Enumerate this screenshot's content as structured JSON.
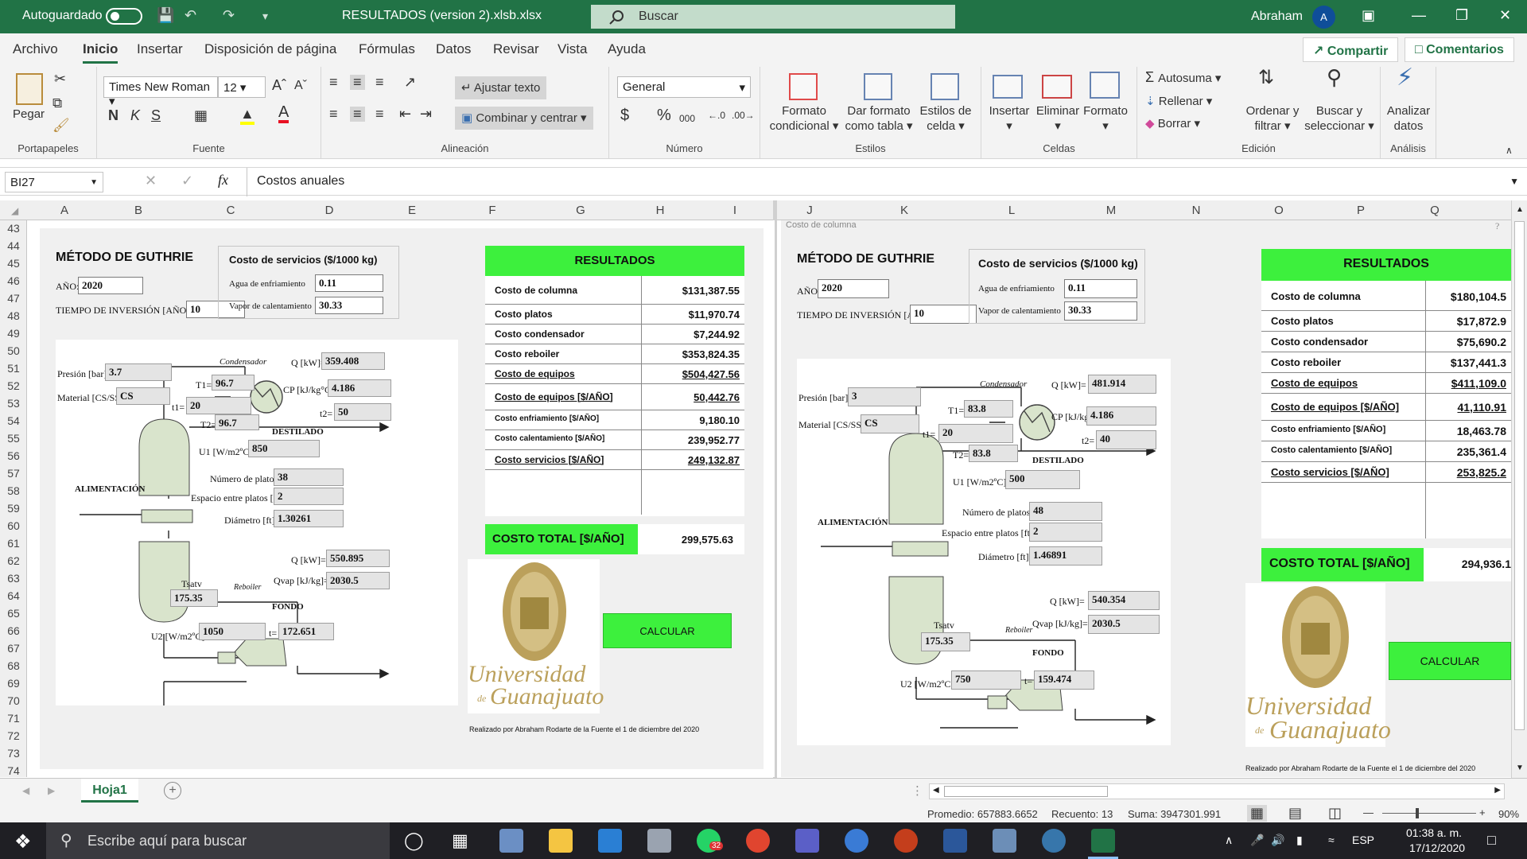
{
  "titlebar": {
    "autosave_label": "Autoguardado",
    "filename": "RESULTADOS (version 2).xlsb.xlsx",
    "search_placeholder": "Buscar",
    "user_name": "Abraham",
    "user_initial": "A"
  },
  "menu": {
    "tabs": [
      "Archivo",
      "Inicio",
      "Insertar",
      "Disposición de página",
      "Fórmulas",
      "Datos",
      "Revisar",
      "Vista",
      "Ayuda"
    ],
    "active_tab": "Inicio",
    "share_label": "Compartir",
    "comments_label": "Comentarios"
  },
  "ribbon": {
    "clipboard": {
      "paste": "Pegar",
      "group": "Portapapeles"
    },
    "font": {
      "family": "Times New Roman",
      "size": "12",
      "bold": "N",
      "italic": "K",
      "underline": "S",
      "group": "Fuente"
    },
    "alignment": {
      "wrap": "Ajustar texto",
      "merge": "Combinar y centrar",
      "group": "Alineación"
    },
    "number": {
      "format": "General",
      "percent": "%",
      "thousands": "000",
      "group": "Número"
    },
    "styles": {
      "cond1": "Formato",
      "cond2": "condicional",
      "table1": "Dar formato",
      "table2": "como tabla",
      "cell1": "Estilos de",
      "cell2": "celda",
      "group": "Estilos"
    },
    "cells": {
      "insert": "Insertar",
      "delete": "Eliminar",
      "format": "Formato",
      "group": "Celdas"
    },
    "editing": {
      "autosum": "Autosuma",
      "fill": "Rellenar",
      "clear": "Borrar",
      "sort1": "Ordenar y",
      "sort2": "filtrar",
      "find1": "Buscar y",
      "find2": "seleccionar",
      "group": "Edición"
    },
    "analysis": {
      "analyze1": "Analizar",
      "analyze2": "datos",
      "group": "Análisis"
    }
  },
  "formula_bar": {
    "cell_ref": "BI27",
    "content": "Costos anuales"
  },
  "columns_left": [
    "A",
    "B",
    "C",
    "D",
    "E",
    "F",
    "G",
    "H",
    "I"
  ],
  "columns_right": [
    "J",
    "K",
    "L",
    "M",
    "N",
    "O",
    "P",
    "Q"
  ],
  "rows": [
    "43",
    "44",
    "45",
    "46",
    "47",
    "48",
    "49",
    "50",
    "51",
    "52",
    "53",
    "54",
    "55",
    "56",
    "57",
    "58",
    "59",
    "60",
    "61",
    "62",
    "63",
    "64",
    "65",
    "66",
    "67",
    "68",
    "69",
    "70",
    "71",
    "72",
    "73",
    "74"
  ],
  "left_pane": {
    "title": "MÉTODO DE GUTHRIE",
    "ano_label": "AÑO:",
    "ano": "2020",
    "tiempo_label": "TIEMPO DE INVERSIÓN [AÑOS]:",
    "tiempo": "10",
    "servicios_title": "Costo de servicios ($/1000 kg)",
    "agua_label": "Agua de enfriamiento",
    "agua": "0.11",
    "vapor_label": "Vapor de calentamiento",
    "vapor": "30.33",
    "presion_label": "Presión [bar]:",
    "presion": "3.7",
    "material_label": "Material [CS/SS]:",
    "material": "CS",
    "condensador_label": "Condensador",
    "q_cond_label": "Q [kW]=",
    "q_cond": "359.408",
    "t1_label": "T1=",
    "t1": "96.7",
    "cp_label": "CP [kJ/kg°C]=",
    "cp": "4.186",
    "t1b_label": "t1=",
    "t1b": "20",
    "t2b_label": "t2=",
    "t2b": "50",
    "t2_label": "T2=",
    "t2": "96.7",
    "destilado": "DESTILADO",
    "u1_label": "U1 [W/m2ºC]",
    "u1": "850",
    "platos_label": "Número de platos:",
    "platos": "38",
    "alimentacion": "ALIMENTACIÓN",
    "espacio_label": "Espacio entre platos [ft]:",
    "espacio": "2",
    "diametro_label": "Diámetro [ft]:",
    "diametro": "1.30261",
    "q_reb_label": "Q [kW]=",
    "q_reb": "550.895",
    "qvap_label": "Qvap [kJ/kg]=",
    "qvap": "2030.5",
    "tsatv_label": "Tsatv",
    "tsatv": "175.35",
    "reboiler": "Reboiler",
    "fondo": "FONDO",
    "u2_label": "U2 [W/m2ºC]",
    "u2": "1050",
    "t_label": "t=",
    "t": "172.651",
    "results_title": "RESULTADOS",
    "results": [
      {
        "k": "Costo de columna",
        "v": "$131,387.55"
      },
      {
        "k": "Costo platos",
        "v": "$11,970.74"
      },
      {
        "k": "Costo condensador",
        "v": "$7,244.92"
      },
      {
        "k": "Costo reboiler",
        "v": "$353,824.35"
      },
      {
        "k": "Costo de equipos",
        "v": "$504,427.56"
      },
      {
        "k": "Costo de equipos [$/AÑO]",
        "v": "50,442.76"
      },
      {
        "k": "Costo enfriamiento [$/AÑO]",
        "v": "9,180.10"
      },
      {
        "k": "Costo calentamiento [$/AÑO]",
        "v": "239,952.77"
      },
      {
        "k": "Costo servicios [$/AÑO]",
        "v": "249,132.87"
      }
    ],
    "total_label": "COSTO TOTAL [$/AÑO]",
    "total": "299,575.63",
    "calcular": "CALCULAR",
    "ug_line1": "Universidad",
    "ug_de": "de",
    "ug_line2": "Guanajuato",
    "credit": "Realizado por Abraham Rodarte de la Fuente el 1 de diciembre del 2020"
  },
  "right_pane": {
    "window_caption": "Costo de columna",
    "help": "?",
    "title": "MÉTODO DE GUTHRIE",
    "ano_label": "AÑO:",
    "ano": "2020",
    "tiempo_label": "TIEMPO DE INVERSIÓN [AÑOS]:",
    "tiempo": "10",
    "servicios_title": "Costo de servicios ($/1000 kg)",
    "agua_label": "Agua de enfriamiento",
    "agua": "0.11",
    "vapor_label": "Vapor de calentamiento",
    "vapor": "30.33",
    "presion_label": "Presión [bar]:",
    "presion": "3",
    "material_label": "Material [CS/SS]:",
    "material": "CS",
    "condensador_label": "Condensador",
    "q_cond_label": "Q [kW]=",
    "q_cond": "481.914",
    "t1_label": "T1=",
    "t1": "83.8",
    "cp_label": "CP [kJ/kg°C]=",
    "cp": "4.186",
    "t1b_label": "t1=",
    "t1b": "20",
    "t2b_label": "t2=",
    "t2b": "40",
    "t2_label": "T2=",
    "t2": "83.8",
    "destilado": "DESTILADO",
    "u1_label": "U1 [W/m2ºC]",
    "u1": "500",
    "platos_label": "Número de platos:",
    "platos": "48",
    "alimentacion": "ALIMENTACIÓN",
    "espacio_label": "Espacio entre platos [ft]:",
    "espacio": "2",
    "diametro_label": "Diámetro [ft]:",
    "diametro": "1.46891",
    "q_reb_label": "Q [kW]=",
    "q_reb": "540.354",
    "qvap_label": "Qvap [kJ/kg]=",
    "qvap": "2030.5",
    "tsatv_label": "Tsatv",
    "tsatv": "175.35",
    "reboiler": "Reboiler",
    "fondo": "FONDO",
    "u2_label": "U2 [W/m2ºC]",
    "u2": "750",
    "t_label": "t=",
    "t": "159.474",
    "results_title": "RESULTADOS",
    "results": [
      {
        "k": "Costo de columna",
        "v": "$180,104.5"
      },
      {
        "k": "Costo platos",
        "v": "$17,872.9"
      },
      {
        "k": "Costo condensador",
        "v": "$75,690.2"
      },
      {
        "k": "Costo reboiler",
        "v": "$137,441.3"
      },
      {
        "k": "Costo de equipos",
        "v": "$411,109.0"
      },
      {
        "k": "Costo de equipos [$/AÑO]",
        "v": "41,110.91"
      },
      {
        "k": "Costo enfriamiento [$/AÑO]",
        "v": "18,463.78"
      },
      {
        "k": "Costo calentamiento [$/AÑO]",
        "v": "235,361.4"
      },
      {
        "k": "Costo servicios [$/AÑO]",
        "v": "253,825.2"
      }
    ],
    "total_label": "COSTO TOTAL [$/AÑO]",
    "total": "294,936.1",
    "calcular": "CALCULAR",
    "ug_line1": "Universidad",
    "ug_de": "de",
    "ug_line2": "Guanajuato",
    "credit": "Realizado por Abraham Rodarte de la Fuente el 1 de diciembre del 2020"
  },
  "sheet_tab": "Hoja1",
  "status": {
    "promedio": "Promedio: 657883.6652",
    "recuento": "Recuento: 13",
    "suma": "Suma: 3947301.991",
    "zoom": "90%"
  },
  "taskbar": {
    "search": "Escribe aquí para buscar",
    "whatsapp_badge": "32",
    "lang": "ESP",
    "time": "01:38 a. m.",
    "date": "17/12/2020"
  },
  "colors": {
    "excel_green": "#217346",
    "result_green": "#3df03d",
    "ug_gold": "#bba05b"
  }
}
